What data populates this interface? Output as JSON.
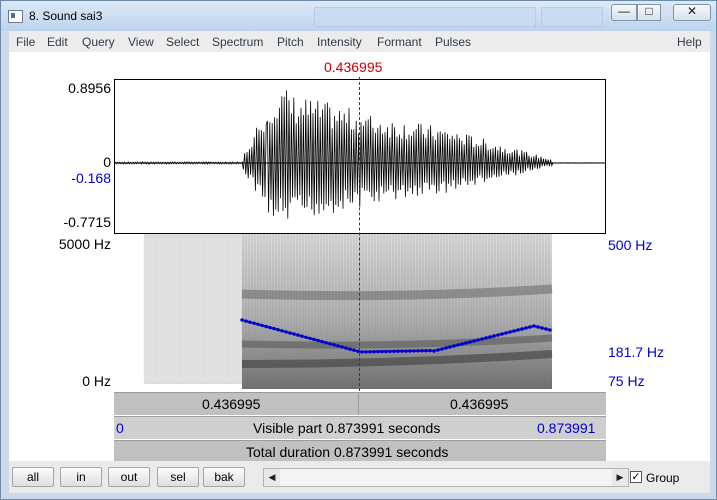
{
  "window": {
    "title": "8. Sound sai3"
  },
  "menu": [
    "File",
    "Edit",
    "Query",
    "View",
    "Select",
    "Spectrum",
    "Pitch",
    "Intensity",
    "Formant",
    "Pulses"
  ],
  "help": "Help",
  "cursor_time": "0.436995",
  "waveform": {
    "max": "0.8956",
    "zero": "0",
    "cursor_value": "-0.168",
    "min": "-0.7715"
  },
  "spectrogram": {
    "top_freq": "5000 Hz",
    "bottom_freq": "0 Hz"
  },
  "pitch": {
    "top": "500 Hz",
    "value": "181.7 Hz",
    "bottom": "75 Hz"
  },
  "bars": {
    "left_time": "0.436995",
    "right_time": "0.436995",
    "visible_start": "0",
    "visible_label": "Visible part 0.873991 seconds",
    "visible_end": "0.873991",
    "total_label": "Total duration 0.873991 seconds"
  },
  "buttons": {
    "all": "all",
    "in": "in",
    "out": "out",
    "sel": "sel",
    "bak": "bak"
  },
  "group": {
    "label": "Group",
    "checked": true
  },
  "colors": {
    "cursor": "#cc0000",
    "pitch": "#0000cc",
    "waveform": "#000000"
  }
}
